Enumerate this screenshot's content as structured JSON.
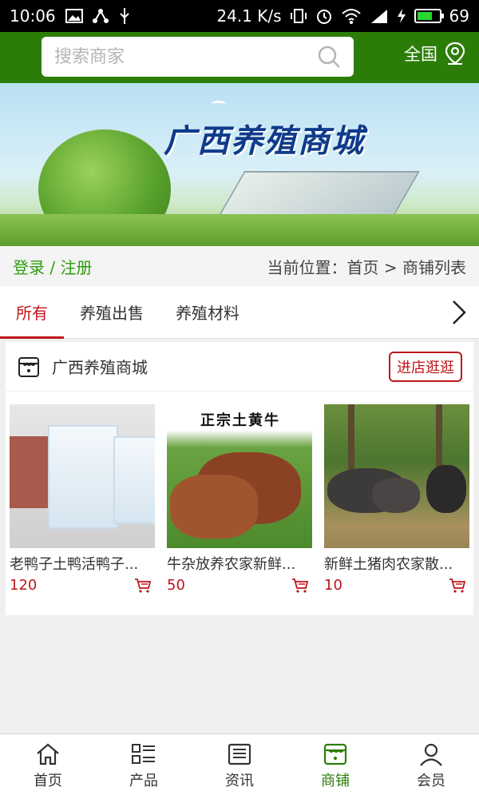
{
  "status_bar": {
    "time": "10:06",
    "speed": "24.1 K/s",
    "battery": "69"
  },
  "header": {
    "search_placeholder": "搜索商家",
    "region": "全国"
  },
  "banner": {
    "title": "广西养殖商城"
  },
  "crumb_bar": {
    "login": "登录 / 注册",
    "location": "当前位置：首页 > 商铺列表"
  },
  "tabs": [
    {
      "label": "所有",
      "active": true
    },
    {
      "label": "养殖出售",
      "active": false
    },
    {
      "label": "养殖材料",
      "active": false
    }
  ],
  "shop": {
    "name": "广西养殖商城",
    "visit_label": "进店逛逛",
    "products": [
      {
        "title": "老鸭子土鸭活鸭子...",
        "price": "120"
      },
      {
        "title": "牛杂放养农家新鲜...",
        "price": "50",
        "image_caption": "正宗土黄牛"
      },
      {
        "title": "新鲜土猪肉农家散...",
        "price": "10"
      }
    ]
  },
  "bottom_nav": [
    {
      "label": "首页",
      "icon": "home-icon",
      "active": false
    },
    {
      "label": "产品",
      "icon": "list-icon",
      "active": false
    },
    {
      "label": "资讯",
      "icon": "news-icon",
      "active": false
    },
    {
      "label": "商铺",
      "icon": "store-icon",
      "active": true
    },
    {
      "label": "会员",
      "icon": "user-icon",
      "active": false
    }
  ],
  "colors": {
    "header_green": "#2c7d08",
    "accent_red": "#c0151a",
    "login_green": "#2c9d0e"
  }
}
